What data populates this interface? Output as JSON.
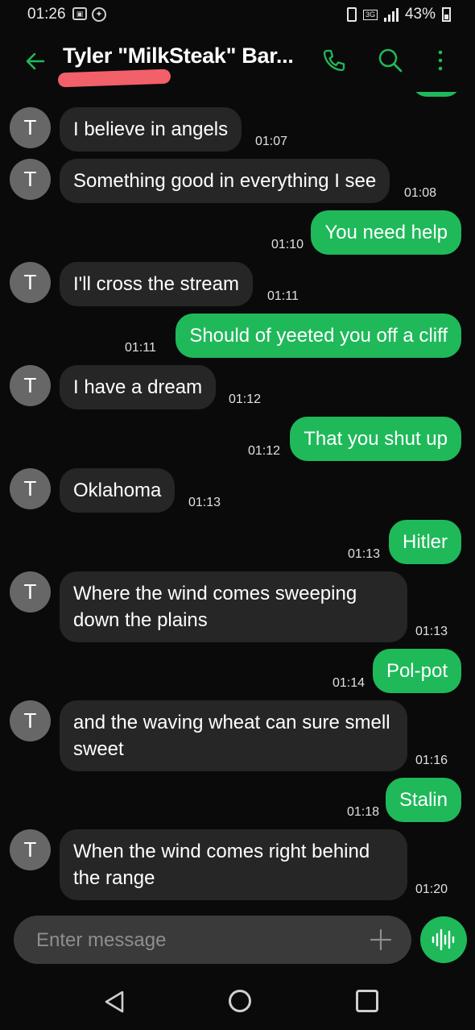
{
  "status_bar": {
    "time": "01:26",
    "network": "3G",
    "battery": "43%"
  },
  "header": {
    "contact_name": "Tyler \"MilkSteak\" Bar..."
  },
  "avatar_letter": "T",
  "messages": [
    {
      "dir": "in",
      "text": "I believe in angels",
      "time": "01:07"
    },
    {
      "dir": "in",
      "text": "Something good in everything I see",
      "time": "01:08"
    },
    {
      "dir": "out",
      "text": "You need help",
      "time": "01:10"
    },
    {
      "dir": "in",
      "text": "I'll cross the stream",
      "time": "01:11"
    },
    {
      "dir": "out",
      "text": "Should of yeeted you off a cliff",
      "time": "01:11"
    },
    {
      "dir": "in",
      "text": "I have a dream",
      "time": "01:12"
    },
    {
      "dir": "out",
      "text": "That you shut up",
      "time": "01:12"
    },
    {
      "dir": "in",
      "text": "Oklahoma",
      "time": "01:13"
    },
    {
      "dir": "out",
      "text": "Hitler",
      "time": "01:13"
    },
    {
      "dir": "in",
      "text": "Where the wind comes sweeping down the plains",
      "time": "01:13"
    },
    {
      "dir": "out",
      "text": "Pol-pot",
      "time": "01:14"
    },
    {
      "dir": "in",
      "text": "and the waving wheat can sure smell sweet",
      "time": "01:16"
    },
    {
      "dir": "out",
      "text": "Stalin",
      "time": "01:18"
    },
    {
      "dir": "in",
      "text": "When the wind comes right behind the range",
      "time": "01:20"
    }
  ],
  "composer": {
    "placeholder": "Enter message"
  },
  "colors": {
    "accent": "#1fb95a",
    "incoming_bubble": "#262626",
    "background": "#0a0a0a"
  }
}
